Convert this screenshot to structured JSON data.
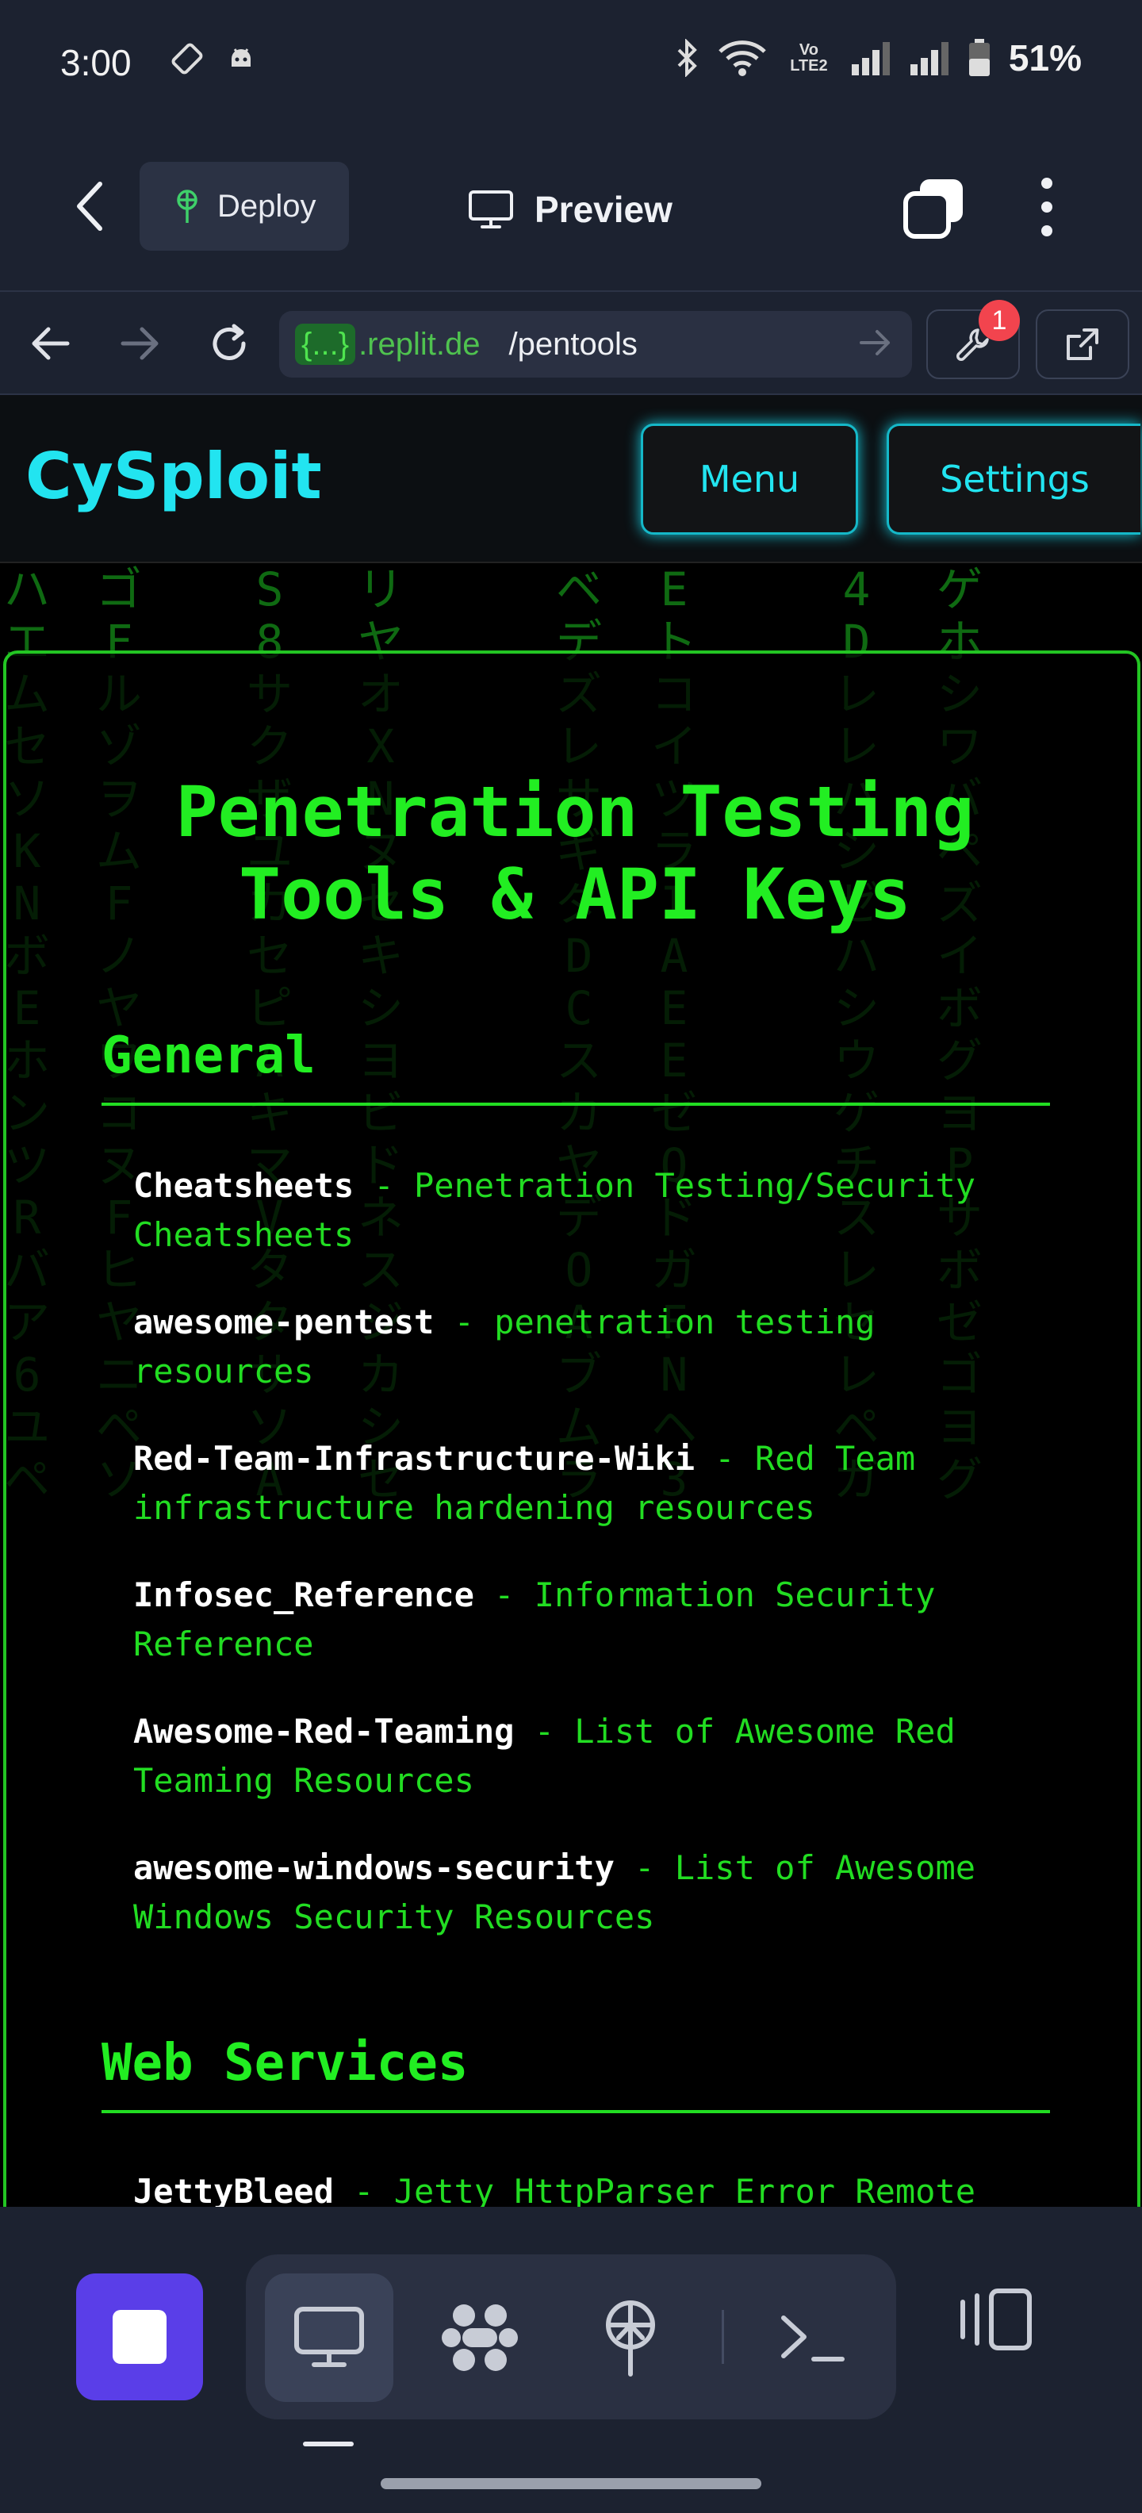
{
  "status_bar": {
    "time": "3:00",
    "battery": "51%",
    "icons": [
      "auto-rotate-icon",
      "android-icon",
      "bluetooth-icon",
      "wifi-icon",
      "volte-icon",
      "signal-icon",
      "signal-icon",
      "battery-icon"
    ],
    "network_label": "Vo LTE2"
  },
  "app_header": {
    "deploy_label": "Deploy",
    "preview_label": "Preview"
  },
  "browser": {
    "url_host_tag": "{...}",
    "url_host": ".replit.de",
    "url_path": "/pentools",
    "devtools_badge": "1"
  },
  "site": {
    "brand": "CySploit",
    "menu_label": "Menu",
    "settings_label": "Settings",
    "page_title_line1": "Penetration Testing",
    "page_title_line2": "Tools & API Keys"
  },
  "sections": [
    {
      "title": "General",
      "tools": [
        {
          "name": "Cheatsheets",
          "desc": " - Penetration Testing/Security Cheatsheets"
        },
        {
          "name": "awesome-pentest",
          "desc": " - penetration testing resources"
        },
        {
          "name": "Red-Team-Infrastructure-Wiki",
          "desc": " - Red Team infrastructure hardening resources"
        },
        {
          "name": "Infosec_Reference",
          "desc": " - Information Security Reference"
        },
        {
          "name": "Awesome-Red-Teaming",
          "desc": " - List of Awesome Red Teaming Resources"
        },
        {
          "name": "awesome-windows-security",
          "desc": " - List of Awesome Windows Security Resources"
        }
      ]
    },
    {
      "title": "Web Services",
      "tools": [
        {
          "name": "JettyBleed",
          "desc": " - Jetty HttpParser Error Remote"
        }
      ]
    }
  ],
  "matrix_columns": [
    "ハ\nエ\nム\nセ\nソ\nK\nN\nボ\nE\nホ\nン\nツ\nR\nバ\nア\n6\nユ\nペ",
    "ゴ\nF\nル\nゾ\nヲ\nム\nF\nノ\nヤ\nワ\nコ\nヌ\nF\nヒ\nヤ\nニ\nペ\nソ",
    "S\n8\nサ\nク\nザ\nユ\nカ\nセ\nピ\nA\nキ\nマ\nV\nタ\nタ\nサ\nソ\nA",
    "リ\nヤ\nオ\nX\nN\nヌ\nセ\nキ\nシ\nヨ\nビ\nド\nネ\nス\nジ\nカ\nシ\nセ",
    "ベ\nデ\nズ\nレ\nサ\nギ\nダ\nD\nC\nス\nカ\nヤ\nデ\nO\nA\nブ\nム\nラ",
    "E\nト\nコ\nイ\nツ\nラ\nI\nA\nE\nE\nゼ\nQ\nド\nガ\nF\nN\nヘ\n3",
    "4\nD\nレ\nレ\nハ\nシ\nゼ\nハ\nシ\nウ\nゲ\nチ\nス\nレ\nセ\nレ\nペ\nガ",
    "ゲ\nホ\nシ\nワ\nバ\nペ\nズ\nイ\nボ\nグ\nヨ\nP\nサ\nボ\nゼ\nゴ\nヨ\nグ"
  ]
}
